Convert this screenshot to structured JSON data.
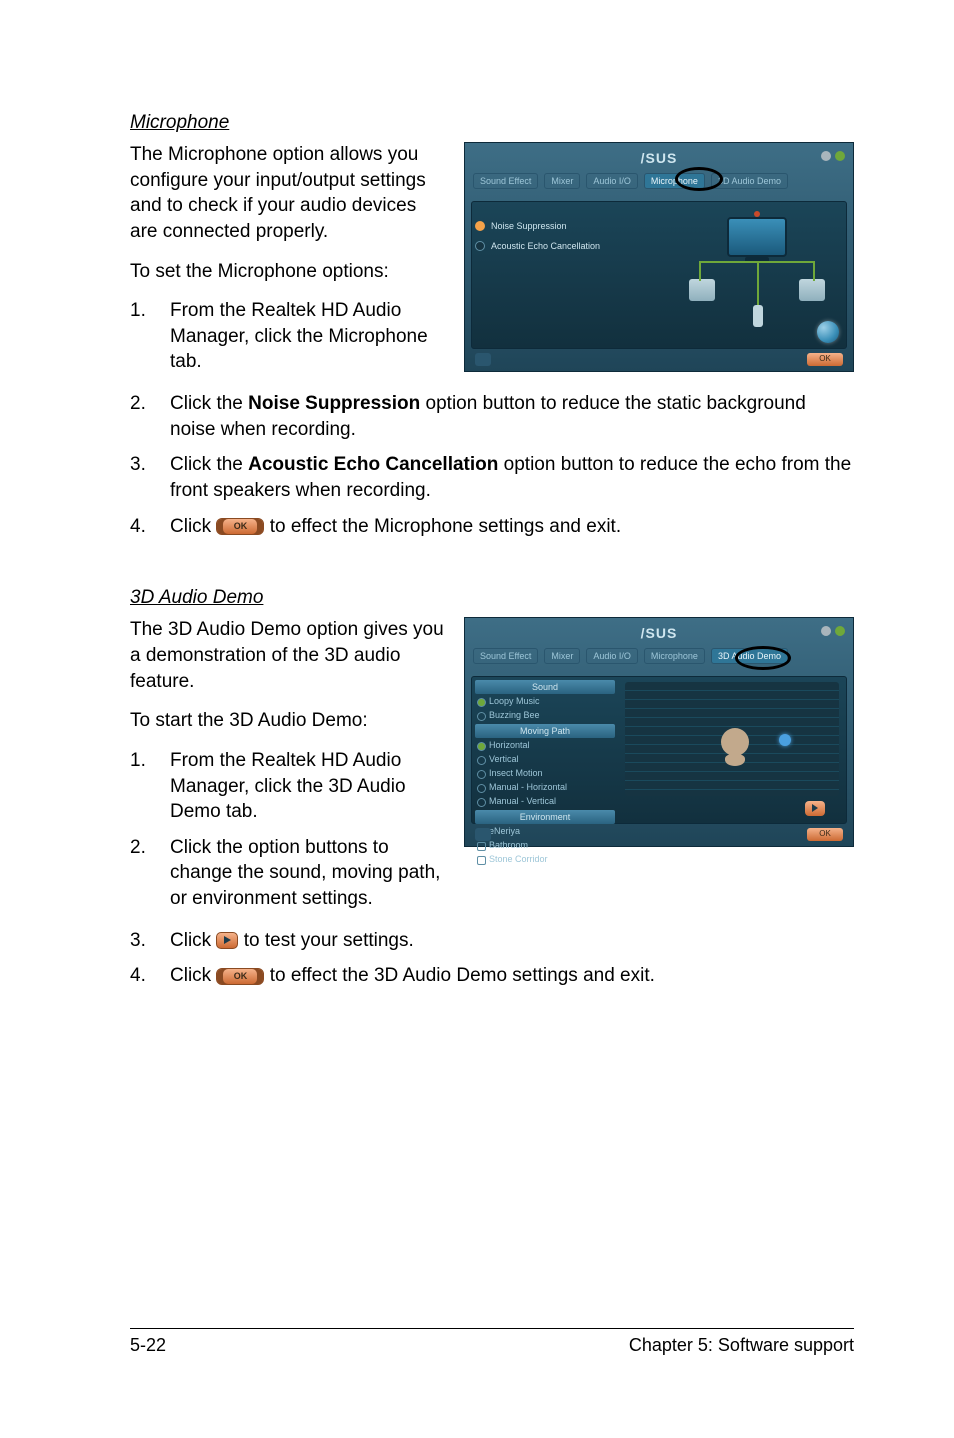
{
  "sections": {
    "microphone": {
      "title": "Microphone",
      "intro": "The Microphone option allows you configure your input/output settings and to check if your audio devices are connected properly.",
      "lead": "To set the Microphone options:",
      "step1": "From the Realtek HD Audio Manager, click the Microphone tab.",
      "step2_a": "Click the ",
      "step2_b": "Noise Suppression",
      "step2_c": " option button to reduce the static background noise when recording.",
      "step3_a": "Click the ",
      "step3_b": "Acoustic Echo Cancellation",
      "step3_c": " option button to reduce the echo from the front speakers when recording.",
      "step4_a": "Click ",
      "step4_b": " to effect the Microphone settings and exit."
    },
    "demo3d": {
      "title": "3D Audio Demo",
      "intro": "The 3D Audio Demo option gives you a demonstration of the 3D audio feature.",
      "lead": "To start the 3D Audio Demo:",
      "step1": "From the Realtek HD Audio Manager, click the 3D Audio Demo tab.",
      "step2": "Click the option buttons to change the sound, moving path, or environment settings.",
      "step3_a": "Click ",
      "step3_b": " to test your settings.",
      "step4_a": "Click ",
      "step4_b": " to effect the 3D Audio Demo settings and exit."
    }
  },
  "step_nums": {
    "n1": "1.",
    "n2": "2.",
    "n3": "3.",
    "n4": "4."
  },
  "ok_label": "OK",
  "screenshot1": {
    "logo": "/SUS",
    "tabs": {
      "t1": "Sound Effect",
      "t2": "Mixer",
      "t3": "Audio I/O",
      "t4": "Microphone",
      "t5": "3D Audio Demo"
    },
    "opt1": "Noise Suppression",
    "opt2": "Acoustic Echo Cancellation",
    "footer_ok": "OK"
  },
  "screenshot2": {
    "logo": "/SUS",
    "tabs": {
      "t1": "Sound Effect",
      "t2": "Mixer",
      "t3": "Audio I/O",
      "t4": "Microphone",
      "t5": "3D Audio Demo"
    },
    "group_sound": {
      "hdr": "Sound",
      "i1": "Loopy Music",
      "i2": "Buzzing Bee"
    },
    "group_path": {
      "hdr": "Moving Path",
      "i1": "Horizontal",
      "i2": "Vertical",
      "i3": "Insect Motion",
      "i4": "Manual - Horizontal",
      "i5": "Manual - Vertical"
    },
    "group_env": {
      "hdr": "Environment",
      "i1": "eNeriya",
      "i2": "Bathroom",
      "i3": "Stone Corridor"
    },
    "footer_ok": "OK"
  },
  "footer": {
    "left": "5-22",
    "right": "Chapter 5: Software support"
  }
}
